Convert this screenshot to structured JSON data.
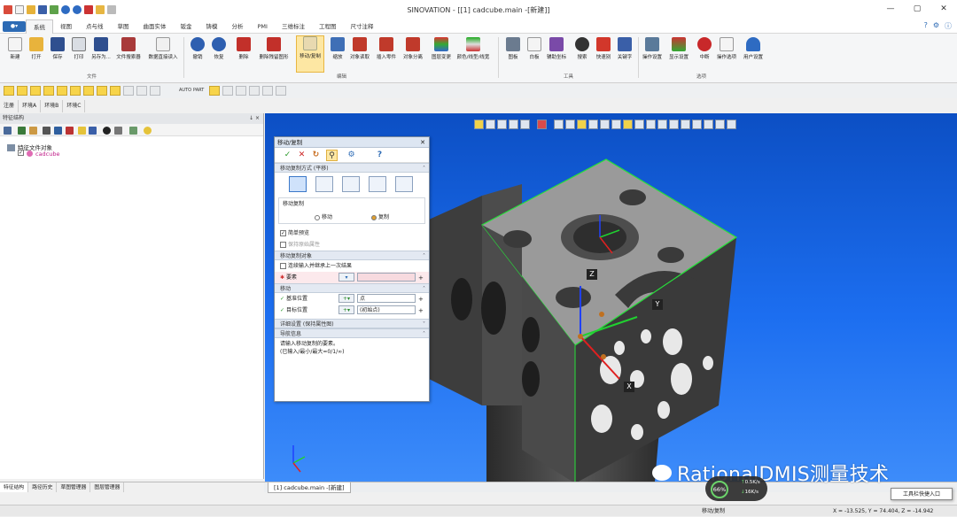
{
  "window": {
    "title": "SINOVATION - [[1] cadcube.main -[新建]]",
    "controls": [
      "—",
      "▢",
      "✕"
    ]
  },
  "menu": {
    "app_button": "●▾",
    "tabs": [
      "系统",
      "视图",
      "点与线",
      "草图",
      "曲面实体",
      "钣金",
      "铸模",
      "分析",
      "PMI",
      "三维标注",
      "工程图",
      "尺寸注释"
    ],
    "active_tab": 0
  },
  "ribbon": {
    "file_buttons": [
      "新建",
      "打开",
      "保存",
      "打印",
      "另存为...",
      "文件搜索器",
      "数据直接读入"
    ],
    "file_group": "文件",
    "edit_buttons": [
      "撤销",
      "恢复",
      "删除",
      "删除残留图形",
      "移动/复制",
      "缩放",
      "对象读取",
      "插入零件",
      "对象分离",
      "图层变更",
      "颜色/线型/线宽"
    ],
    "edit_group": "编辑",
    "tool_buttons": [
      "图板",
      "白板",
      "辅助坐标",
      "搜索",
      "快速别",
      "关键字"
    ],
    "tool_group": "工具",
    "option_buttons": [
      "操作设置",
      "显示设置",
      "中断",
      "操作选项",
      "用户设置"
    ],
    "option_group": "选项"
  },
  "toolrow": {
    "auto_label": "AUTO",
    "part_label": "PART"
  },
  "env_tabs": [
    "注册",
    "环境A",
    "环境B",
    "环境C"
  ],
  "left_panel": {
    "title": "特征结构",
    "pin": "↓ ×",
    "tree_root": "特征文件对象",
    "tree_child": "cadcube"
  },
  "bottom_tabs": [
    "特征结构",
    "路径历史",
    "草图管理器",
    "图层管理器"
  ],
  "doc_tab": "[1] cadcube.main -[新建]",
  "status": {
    "left": "移动/复制",
    "coords": "X = -13.525, Y = 74.404, Z = -14.942"
  },
  "dialog": {
    "title": "移动/复制",
    "close": "✕",
    "section_mode": "移动复制方式 (平移)",
    "move_copy_label": "移动复制",
    "radio_move": "移动",
    "radio_copy": "复制",
    "preview_label": "简单预览",
    "keep_original": "保持原始属性",
    "section_objects": "移动复制对象",
    "continue_label": "连续输入并继承上一次结果",
    "element_label": "要素",
    "section_move": "移动",
    "base_label": "基准位置",
    "base_value": "点",
    "target_label": "目标位置",
    "target_value": "(初始点)",
    "section_detail": "详细设置 (保持属性图)",
    "section_guide": "导航信息",
    "guide_line1": "请输入移动复制的要素。",
    "guide_line2": "(已输入/最小/最大=0/1/∞)"
  },
  "viewport": {
    "axis_x": "X",
    "axis_y": "Y",
    "axis_z": "Z"
  },
  "watermark": "RationalDMIS测量技术",
  "speed": {
    "percent": "66%",
    "up": "0.5K/s",
    "down": "16K/s"
  },
  "toast": "工具栏快捷入口",
  "colors": {
    "viewport_top": "#0c4fc4",
    "viewport_bottom": "#3d8cfa",
    "part_face": "#6e6e6e",
    "edge_highlight": "#27e03a",
    "accent": "#2d6bb5"
  }
}
